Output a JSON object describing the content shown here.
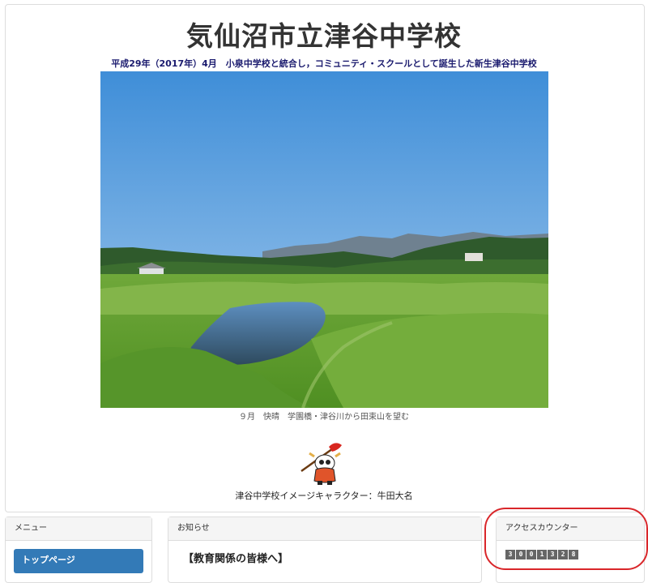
{
  "header": {
    "title": "気仙沼市立津谷中学校",
    "subtitle": "平成29年（2017年）4月　小泉中学校と統合し，コミュニティ・スクールとして誕生した新生津谷中学校",
    "photo_caption": "９月　快晴　学園橋・津谷川から田束山を望む",
    "mascot_caption": "津谷中学校イメージキャラクター：牛田大名"
  },
  "menu": {
    "heading": "メニュー",
    "items": [
      {
        "label": "トップページ"
      }
    ]
  },
  "news": {
    "heading": "お知らせ",
    "first_title": "【教育関係の皆様へ】"
  },
  "counter": {
    "heading": "アクセスカウンター",
    "digits": [
      "3",
      "0",
      "0",
      "1",
      "3",
      "2",
      "8"
    ]
  },
  "colors": {
    "menu_button": "#337ab7",
    "highlight": "#d9262a",
    "subtitle": "#1a1a6e"
  }
}
